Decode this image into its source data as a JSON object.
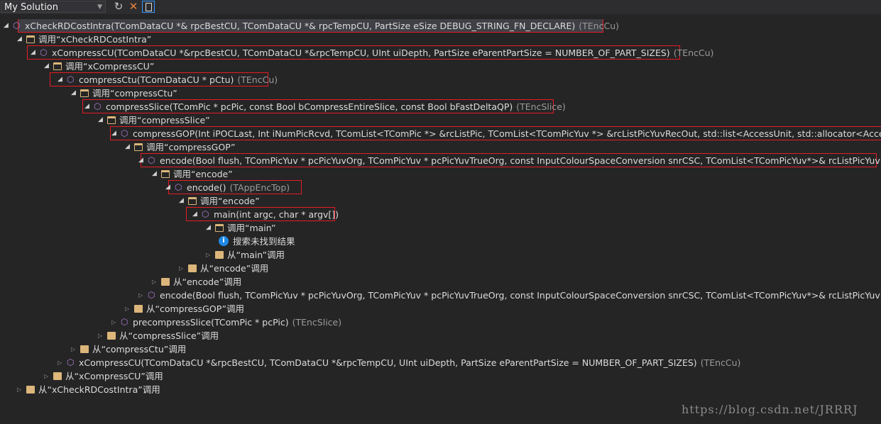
{
  "toolbar": {
    "scope_value": "My Solution",
    "refresh_icon": "refresh-icon",
    "cancel_icon": "close-icon",
    "toggle_icon": "details-pane-icon"
  },
  "colors": {
    "background": "#252526",
    "folder": "#dcb67a",
    "method": "#b180d7",
    "highlight_box": "#e51c23",
    "info": "#1e88e5"
  },
  "tree": [
    {
      "level": 0,
      "state": "expanded",
      "icon": "method",
      "text": "xCheckRDCostIntra(TComDataCU *& rpcBestCU, TComDataCU *& rpcTempCU, PartSize eSize DEBUG_STRING_FN_DECLARE)",
      "cls": "(TEncCu)",
      "selected": true
    },
    {
      "level": 1,
      "state": "expanded",
      "icon": "folder-open",
      "text": "调用“xCheckRDCostIntra”"
    },
    {
      "level": 2,
      "state": "expanded",
      "icon": "method",
      "text": "xCompressCU(TComDataCU *&rpcBestCU, TComDataCU *&rpcTempCU, UInt uiDepth, PartSize eParentPartSize = NUMBER_OF_PART_SIZES)",
      "cls": "(TEncCu)"
    },
    {
      "level": 3,
      "state": "expanded",
      "icon": "folder-open",
      "text": "调用“xCompressCU”"
    },
    {
      "level": 4,
      "state": "expanded",
      "icon": "method",
      "text": "compressCtu(TComDataCU * pCtu)",
      "cls": "(TEncCu)"
    },
    {
      "level": 5,
      "state": "expanded",
      "icon": "folder-open",
      "text": "调用“compressCtu”"
    },
    {
      "level": 6,
      "state": "expanded",
      "icon": "method",
      "text": "compressSlice(TComPic * pcPic, const Bool bCompressEntireSlice, const Bool bFastDeltaQP)",
      "cls": "(TEncSlice)"
    },
    {
      "level": 7,
      "state": "expanded",
      "icon": "folder-open",
      "text": "调用“compressSlice”"
    },
    {
      "level": 8,
      "state": "expanded",
      "icon": "method",
      "text": "compressGOP(Int iPOCLast, Int iNumPicRcvd, TComList<TComPic *> &rcListPic, TComList<TComPicYuv *> &rcListPicYuvRecOut, std::list<AccessUnit, std::allocator<AccessUnit>> &acc"
    },
    {
      "level": 9,
      "state": "expanded",
      "icon": "folder-open",
      "text": "调用“compressGOP”"
    },
    {
      "level": 10,
      "state": "expanded",
      "icon": "method",
      "text": "encode(Bool flush, TComPicYuv * pcPicYuvOrg, TComPicYuv * pcPicYuvTrueOrg, const InputColourSpaceConversion snrCSC, TComList<TComPicYuv*>& rcListPicYuvRecOut, std:"
    },
    {
      "level": 11,
      "state": "expanded",
      "icon": "folder-open",
      "text": "调用“encode”"
    },
    {
      "level": 12,
      "state": "expanded",
      "icon": "method",
      "text": "encode()",
      "cls": "(TAppEncTop)"
    },
    {
      "level": 13,
      "state": "expanded",
      "icon": "folder-open",
      "text": "调用“encode”"
    },
    {
      "level": 14,
      "state": "expanded",
      "icon": "method",
      "text": "main(int argc, char * argv[])"
    },
    {
      "level": 15,
      "state": "expanded",
      "icon": "folder-open",
      "text": "调用“main”"
    },
    {
      "level": 16,
      "state": "none",
      "icon": "info",
      "text": "搜索未找到结果"
    },
    {
      "level": 15,
      "state": "collapsed",
      "icon": "folder",
      "text": "从“main”调用"
    },
    {
      "level": 13,
      "state": "collapsed",
      "icon": "folder",
      "text": "从“encode”调用"
    },
    {
      "level": 11,
      "state": "collapsed",
      "icon": "folder",
      "text": "从“encode”调用"
    },
    {
      "level": 10,
      "state": "collapsed",
      "icon": "method",
      "text": "encode(Bool flush, TComPicYuv * pcPicYuvOrg, TComPicYuv * pcPicYuvTrueOrg, const InputColourSpaceConversion snrCSC, TComList<TComPicYuv*>& rcListPicYuvRecOut, std:"
    },
    {
      "level": 9,
      "state": "collapsed",
      "icon": "folder",
      "text": "从“compressGOP”调用"
    },
    {
      "level": 8,
      "state": "collapsed",
      "icon": "method",
      "text": "precompressSlice(TComPic * pcPic)",
      "cls": "(TEncSlice)"
    },
    {
      "level": 7,
      "state": "collapsed",
      "icon": "folder",
      "text": "从“compressSlice”调用"
    },
    {
      "level": 5,
      "state": "collapsed",
      "icon": "folder",
      "text": "从“compressCtu”调用"
    },
    {
      "level": 4,
      "state": "collapsed",
      "icon": "method",
      "text": "xCompressCU(TComDataCU *&rpcBestCU, TComDataCU *&rpcTempCU, UInt uiDepth, PartSize eParentPartSize = NUMBER_OF_PART_SIZES)",
      "cls": "(TEncCu)"
    },
    {
      "level": 3,
      "state": "collapsed",
      "icon": "folder",
      "text": "从“xCompressCU”调用"
    },
    {
      "level": 1,
      "state": "collapsed",
      "icon": "folder",
      "text": "从“xCheckRDCostIntra”调用"
    }
  ],
  "watermark": "https://blog.csdn.net/JRRRJ"
}
